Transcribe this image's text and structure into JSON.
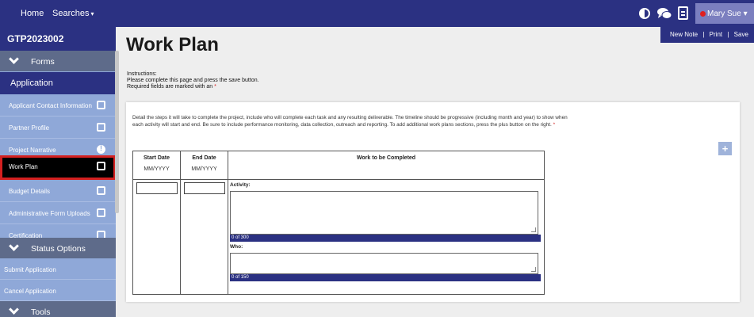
{
  "topbar": {
    "home": "Home",
    "searches": "Searches",
    "searches_caret": "▾",
    "user": "Mary Sue",
    "user_caret": "▾",
    "icons": [
      "contrast-icon",
      "chat-icon",
      "document-icon"
    ]
  },
  "sidebar": {
    "app_id": "GTP2023002",
    "forms": "Forms",
    "application": "Application",
    "items": [
      {
        "label": "Applicant Contact Information",
        "status": "empty"
      },
      {
        "label": "Partner Profile",
        "status": "empty"
      },
      {
        "label": "Project Narrative",
        "status": "warning"
      },
      {
        "label": "Work Plan",
        "status": "empty",
        "active": true
      },
      {
        "label": "Budget Details",
        "status": "empty"
      },
      {
        "label": "Administrative Form Uploads",
        "status": "empty"
      },
      {
        "label": "Certification",
        "status": "empty"
      }
    ],
    "status_options": "Status Options",
    "links": [
      "Submit Application",
      "Cancel Application"
    ],
    "tools": "Tools"
  },
  "actions": {
    "new_note": "New Note",
    "print": "Print",
    "save": "Save",
    "separator": "|"
  },
  "page": {
    "title": "Work Plan",
    "instructions_label": "Instructions:",
    "instructions_line1": "Please complete this page and press the save button.",
    "instructions_line2": "Required fields are marked with an",
    "required_mark": "*"
  },
  "card": {
    "description": "Detail the steps it will take to complete the project, include who will complete each task and any resulting deliverable. The timeline should be progressive (including month and year) to show when each activity will start and end. Be sure to include performance monitoring, data collection, outreach and reporting. To add additional work plans sections, press the plus button on the right.",
    "plus": "+",
    "table": {
      "start_date": "Start Date",
      "end_date": "End Date",
      "work": "Work to be Completed",
      "date_format": "MM/YYYY",
      "activity_label": "Activity:",
      "activity_counter": "0 of 300",
      "who_label": "Who:",
      "who_counter": "0 of 150",
      "start_value": "",
      "end_value": "",
      "activity_value": "",
      "who_value": ""
    }
  },
  "colors": {
    "primary": "#2b3182",
    "sidebar": "#8fa8d8",
    "section": "#5e6b8a",
    "active_border": "#d42020"
  }
}
